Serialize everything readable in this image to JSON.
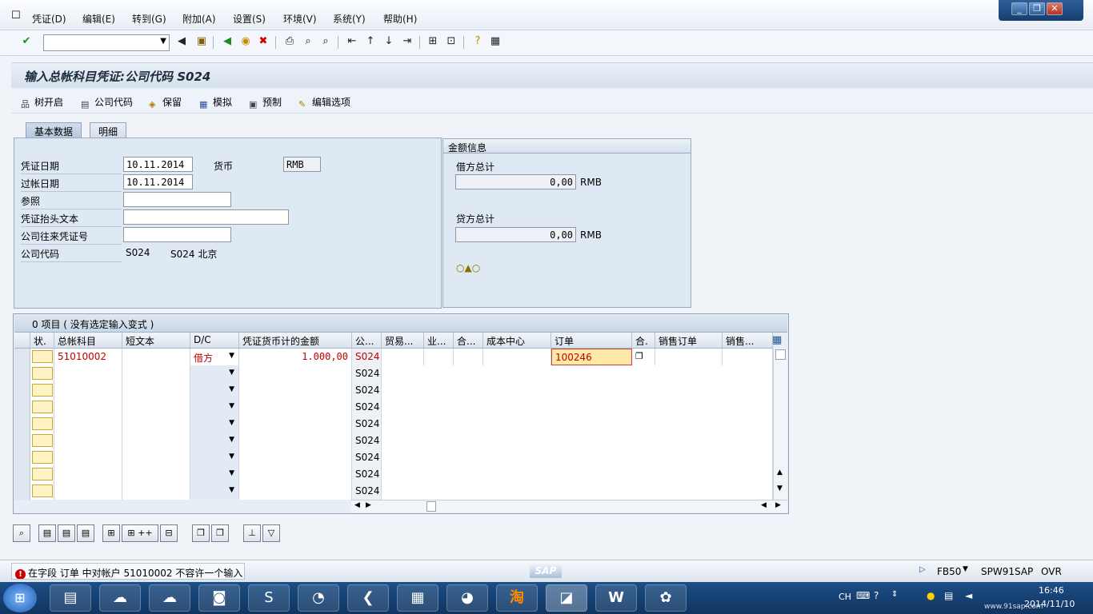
{
  "menu": [
    "凭证(D)",
    "编辑(E)",
    "转到(G)",
    "附加(A)",
    "设置(S)",
    "环境(V)",
    "系统(Y)",
    "帮助(H)"
  ],
  "page_title": "输入总帐科目凭证:公司代码 S024",
  "app_toolbar": [
    "树开启",
    "公司代码",
    "保留",
    "模拟",
    "预制",
    "编辑选项"
  ],
  "tabs": [
    "基本数据",
    "明细"
  ],
  "basic": {
    "doc_date_label": "凭证日期",
    "doc_date": "10.11.2014",
    "currency_label": "货币",
    "currency": "RMB",
    "post_date_label": "过帐日期",
    "post_date": "10.11.2014",
    "reference_label": "参照",
    "header_text_label": "凭证抬头文本",
    "intercompany_label": "公司往来凭证号",
    "company_code_label": "公司代码",
    "company_code": "S024",
    "company_name": "S024 北京"
  },
  "amount": {
    "title": "金额信息",
    "debit_label": "借方总计",
    "debit_value": "0,00",
    "debit_currency": "RMB",
    "credit_label": "贷方总计",
    "credit_value": "0,00",
    "credit_currency": "RMB"
  },
  "grid": {
    "header": "0 项目 ( 没有选定输入变式 )",
    "columns": [
      "状.",
      "总帐科目",
      "短文本",
      "D/C",
      "凭证货币计的金额",
      "公...",
      "贸易...",
      "业...",
      "合...",
      "成本中心",
      "订单",
      "合.",
      "销售订单",
      "销售..."
    ],
    "row1": {
      "account": "51010002",
      "dc": "借方",
      "amount": "1.000,00",
      "company": "S024",
      "order": "100246"
    },
    "company_default": "S024"
  },
  "status": {
    "message": "在字段 订单 中对帐户 51010002 不容许一个输入",
    "transaction": "FB50",
    "system": "SPW91SAP",
    "mode": "OVR",
    "sap_logo": "SAP"
  },
  "taskbar": {
    "lang": "CH",
    "time": "16:46",
    "date": "2014/11/10",
    "watermark": "www.91sap.com"
  }
}
